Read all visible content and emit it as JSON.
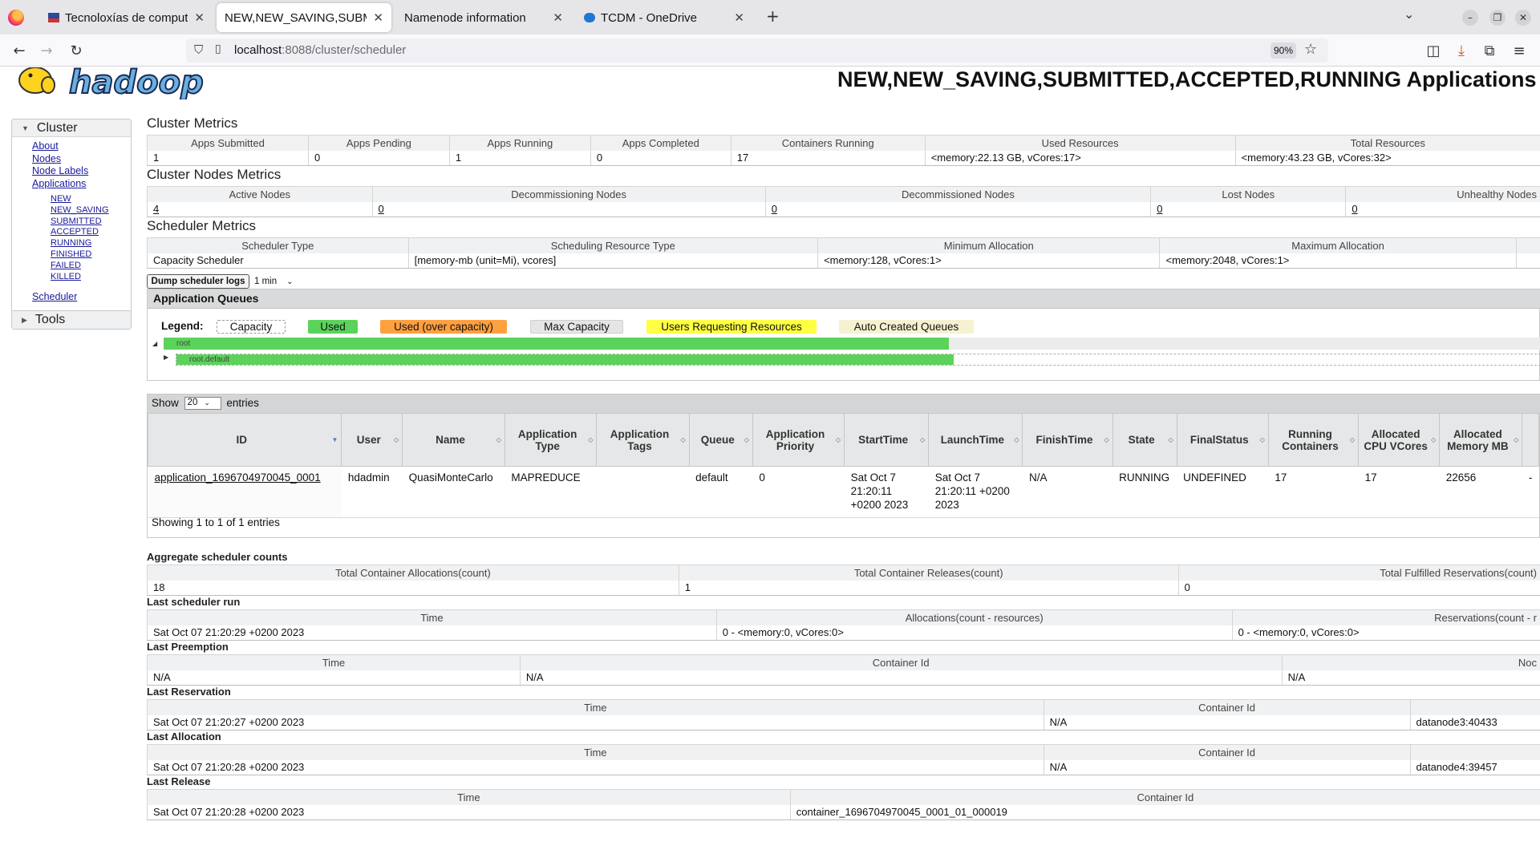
{
  "browser": {
    "tabs": [
      {
        "label": "Tecnoloxías de computac"
      },
      {
        "label": "NEW,NEW_SAVING,SUBMIT"
      },
      {
        "label": "Namenode information"
      },
      {
        "label": "TCDM - OneDrive"
      }
    ],
    "url_host": "localhost",
    "url_path": ":8088/cluster/scheduler",
    "zoom": "90%"
  },
  "page": {
    "logo_text": "hadoop",
    "title": "NEW,NEW_SAVING,SUBMITTED,ACCEPTED,RUNNING Applications"
  },
  "sidebar": {
    "cluster_label": "Cluster",
    "links": [
      "About",
      "Nodes",
      "Node Labels",
      "Applications"
    ],
    "app_states": [
      "NEW",
      "NEW_SAVING",
      "SUBMITTED",
      "ACCEPTED",
      "RUNNING",
      "FINISHED",
      "FAILED",
      "KILLED"
    ],
    "scheduler_link": "Scheduler",
    "tools_label": "Tools"
  },
  "cluster_metrics": {
    "title": "Cluster Metrics",
    "headers": [
      "Apps Submitted",
      "Apps Pending",
      "Apps Running",
      "Apps Completed",
      "Containers Running",
      "Used Resources",
      "Total Resources"
    ],
    "values": [
      "1",
      "0",
      "1",
      "0",
      "17",
      "<memory:22.13 GB, vCores:17>",
      "<memory:43.23 GB, vCores:32>"
    ]
  },
  "nodes_metrics": {
    "title": "Cluster Nodes Metrics",
    "headers": [
      "Active Nodes",
      "Decommissioning Nodes",
      "Decommissioned Nodes",
      "Lost Nodes",
      "Unhealthy Nodes"
    ],
    "values": [
      "4",
      "0",
      "0",
      "0",
      "0"
    ]
  },
  "scheduler_metrics": {
    "title": "Scheduler Metrics",
    "headers": [
      "Scheduler Type",
      "Scheduling Resource Type",
      "Minimum Allocation",
      "Maximum Allocation"
    ],
    "values": [
      "Capacity Scheduler",
      "[memory-mb (unit=Mi), vcores]",
      "<memory:128, vCores:1>",
      "<memory:2048, vCores:1>"
    ]
  },
  "dump": {
    "button": "Dump scheduler logs",
    "interval": "1 min"
  },
  "queues": {
    "title": "Application Queues",
    "legend_label": "Legend:",
    "legend": [
      "Capacity",
      "Used",
      "Used (over capacity)",
      "Max Capacity",
      "Users Requesting Resources",
      "Auto Created Queues"
    ],
    "root_name": "root",
    "root_used_pct": 57,
    "default_name": "root.default",
    "default_used_pct": 57
  },
  "apps_table": {
    "show_label": "Show",
    "page_size": "20",
    "entries_label": "entries",
    "headers": [
      "ID",
      "User",
      "Name",
      "Application Type",
      "Application Tags",
      "Queue",
      "Application Priority",
      "StartTime",
      "LaunchTime",
      "FinishTime",
      "State",
      "FinalStatus",
      "Running Containers",
      "Allocated CPU VCores",
      "Allocated Memory MB"
    ],
    "rows": [
      [
        "application_1696704970045_0001",
        "hdadmin",
        "QuasiMonteCarlo",
        "MAPREDUCE",
        "",
        "default",
        "0",
        "Sat Oct 7 21:20:11 +0200 2023",
        "Sat Oct 7 21:20:11 +0200 2023",
        "N/A",
        "RUNNING",
        "UNDEFINED",
        "17",
        "17",
        "22656"
      ]
    ],
    "footer": "Showing 1 to 1 of 1 entries"
  },
  "aggregate": {
    "title": "Aggregate scheduler counts",
    "headers": [
      "Total Container Allocations(count)",
      "Total Container Releases(count)",
      "Total Fulfilled Reservations(count)"
    ],
    "values": [
      "18",
      "1",
      "0"
    ]
  },
  "last_run": {
    "title": "Last scheduler run",
    "headers": [
      "Time",
      "Allocations(count - resources)",
      "Reservations(count - r"
    ],
    "values": [
      "Sat Oct 07 21:20:29 +0200 2023",
      "0 - <memory:0, vCores:0>",
      "0 - <memory:0, vCores:0>"
    ]
  },
  "last_preemption": {
    "title": "Last Preemption",
    "headers": [
      "Time",
      "Container Id",
      "Noc"
    ],
    "values": [
      "N/A",
      "N/A",
      "N/A"
    ]
  },
  "last_reservation": {
    "title": "Last Reservation",
    "headers": [
      "Time",
      "Container Id",
      ""
    ],
    "values": [
      "Sat Oct 07 21:20:27 +0200 2023",
      "N/A",
      "datanode3:40433"
    ]
  },
  "last_allocation": {
    "title": "Last Allocation",
    "headers": [
      "Time",
      "Container Id",
      ""
    ],
    "values": [
      "Sat Oct 07 21:20:28 +0200 2023",
      "N/A",
      "datanode4:39457"
    ]
  },
  "last_release": {
    "title": "Last Release",
    "headers": [
      "Time",
      "Container Id"
    ],
    "values": [
      "Sat Oct 07 21:20:28 +0200 2023",
      "container_1696704970045_0001_01_000019"
    ]
  },
  "colors": {
    "used": "#5bd35b",
    "over_capacity": "#ffa040",
    "max_capacity": "#e5e5e5",
    "requesting": "#ffff44",
    "auto_created": "#f6f1d0"
  }
}
